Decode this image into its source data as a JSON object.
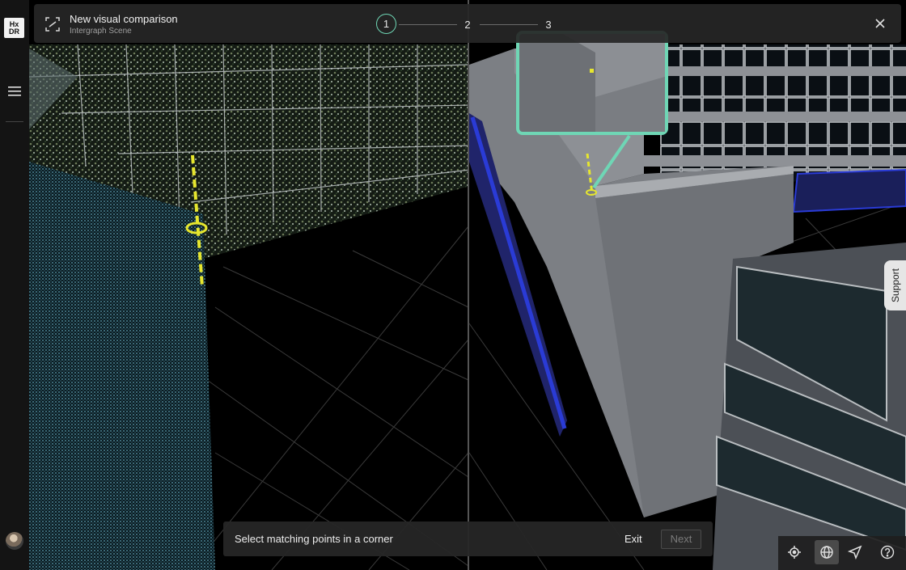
{
  "app": {
    "logo_line1": "Hx",
    "logo_line2": "DR"
  },
  "header": {
    "title": "New visual comparison",
    "subtitle": "Intergraph Scene",
    "icon": "compare-frame-icon",
    "steps": [
      {
        "label": "1",
        "active": true
      },
      {
        "label": "2",
        "active": false
      },
      {
        "label": "3",
        "active": false
      }
    ]
  },
  "bottom_bar": {
    "instruction": "Select matching points in a corner",
    "exit_label": "Exit",
    "next_label": "Next"
  },
  "toolbar": {
    "tools": [
      "locate-icon",
      "globe-icon",
      "navigate-icon",
      "help-icon"
    ],
    "active_tool": "globe-icon"
  },
  "support": {
    "label": "Support"
  },
  "colors": {
    "accent": "#6fd6b5",
    "marker": "#e6e62e",
    "window_blue": "#2a3bd6"
  }
}
